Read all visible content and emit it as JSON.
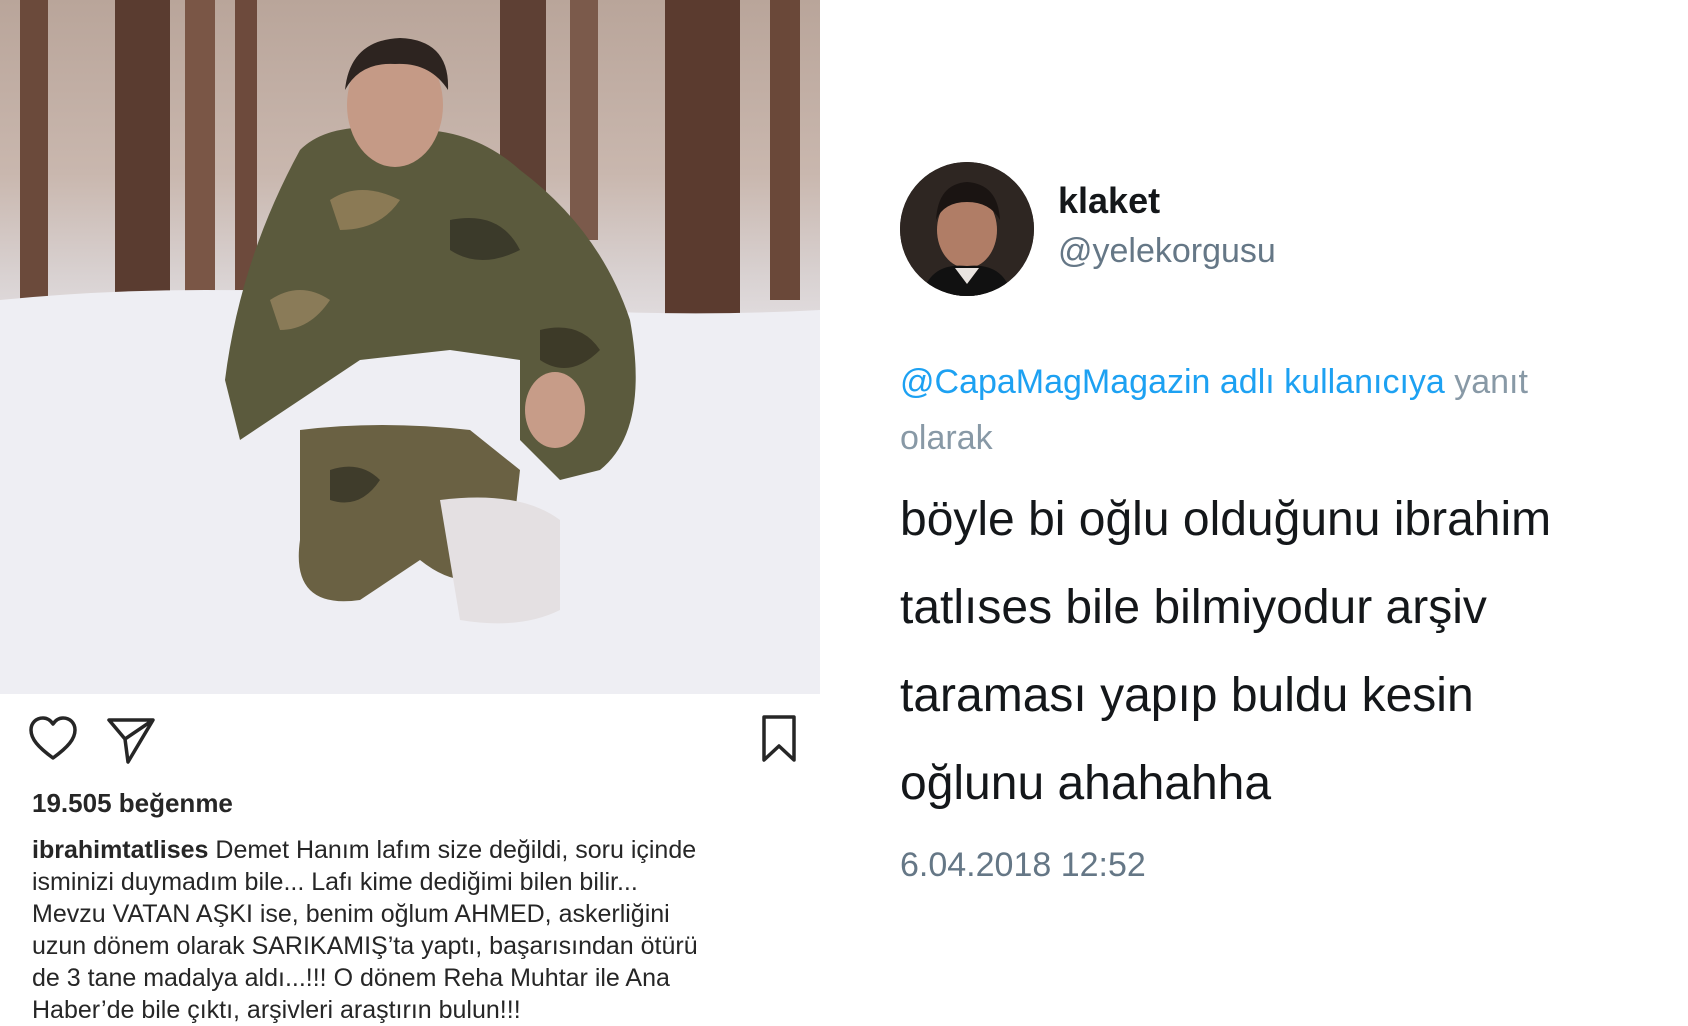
{
  "instagram": {
    "photo": {
      "description_icon": "photo"
    },
    "actions": {
      "like_icon": "heart-icon",
      "share_icon": "paper-plane-icon",
      "save_icon": "bookmark-icon"
    },
    "likes": "19.505 beğenme",
    "caption": {
      "username": "ibrahimtatlises",
      "line1": " Demet Hanım lafım size değildi, soru içinde",
      "line2": "isminizi duymadım bile... Lafı kime dediğimi bilen bilir...",
      "line3": "Mevzu VATAN AŞKI ise, benim oğlum AHMED, askerliğini",
      "line4": "uzun dönem olarak SARIKAMIŞ’ta yaptı, başarısından ötürü",
      "line5": "de 3 tane madalya aldı...!!! O dönem Reha Muhtar ile Ana",
      "line6": "Haber’de bile çıktı, arşivleri araştırın bulun!!!"
    }
  },
  "tweet": {
    "display_name": "klaket",
    "handle": "@yelekorgusu",
    "reply_mention": "@CapaMagMagazin adlı kullanıcıya",
    "reply_suffix_1": " yanıt",
    "reply_suffix_2": "olarak",
    "text_lines": [
      "böyle bi oğlu olduğunu ibrahim",
      "tatlıses bile bilmiyodur arşiv",
      "taraması yapıp buldu kesin",
      "oğlunu ahahahha"
    ],
    "timestamp": "6.04.2018 12:52"
  }
}
